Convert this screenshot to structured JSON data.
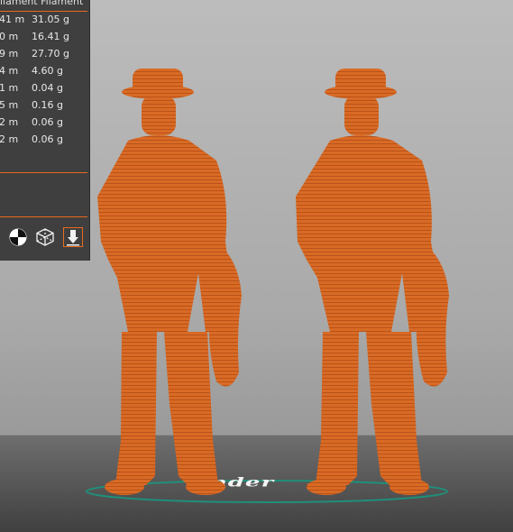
{
  "panel": {
    "header": "ilament Filament",
    "rows": [
      {
        "len": "41 m",
        "wt": "31.05 g"
      },
      {
        "len": "0 m",
        "wt": "16.41 g"
      },
      {
        "len": "9 m",
        "wt": "27.70 g"
      },
      {
        "len": "4 m",
        "wt": "4.60 g"
      },
      {
        "len": "1 m",
        "wt": "0.04 g"
      },
      {
        "len": "5 m",
        "wt": "0.16 g"
      },
      {
        "len": "2 m",
        "wt": "0.06 g"
      },
      {
        "len": "2 m",
        "wt": "0.06 g"
      }
    ],
    "icons": [
      "center-of-mass-icon",
      "wireframe-cube-icon",
      "drop-to-bed-icon"
    ]
  },
  "bed": {
    "logo_text": "Ender"
  },
  "colors": {
    "model": "#d96a24",
    "panel": "#3f3f3f",
    "accent": "#e86a1d",
    "bed_ring": "#1f8f7a"
  }
}
